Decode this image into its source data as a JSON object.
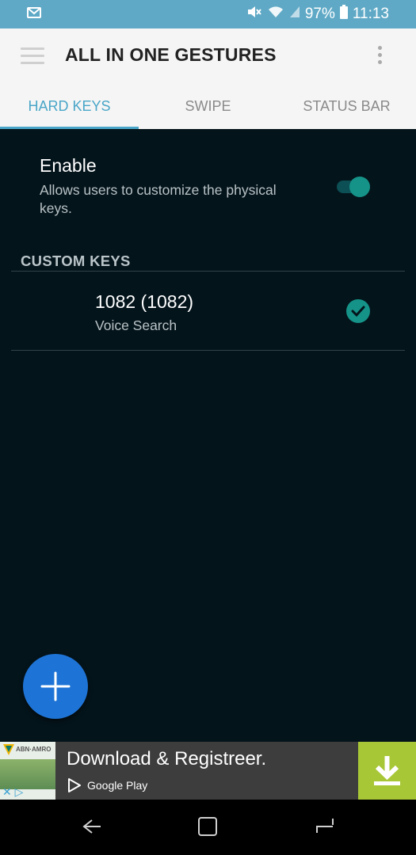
{
  "status": {
    "battery": "97%",
    "time": "11:13"
  },
  "appbar": {
    "title": "ALL IN ONE GESTURES"
  },
  "tabs": [
    {
      "label": "HARD KEYS",
      "active": true
    },
    {
      "label": "SWIPE",
      "active": false
    },
    {
      "label": "STATUS BAR",
      "active": false
    }
  ],
  "enable": {
    "title": "Enable",
    "description": "Allows users to customize the physical keys.",
    "checked": true
  },
  "custom_keys": {
    "header": "CUSTOM KEYS",
    "items": [
      {
        "title": "1082 (1082)",
        "subtitle": "Voice Search",
        "checked": true
      }
    ]
  },
  "ad": {
    "brand": "ABN·AMRO",
    "title": "Download & Registreer.",
    "store": "Google Play"
  },
  "colors": {
    "accent": "#4aa6c8",
    "teal": "#159388",
    "fab": "#1e74d6",
    "background": "#04141b",
    "statusbar": "#5fa9c6"
  }
}
